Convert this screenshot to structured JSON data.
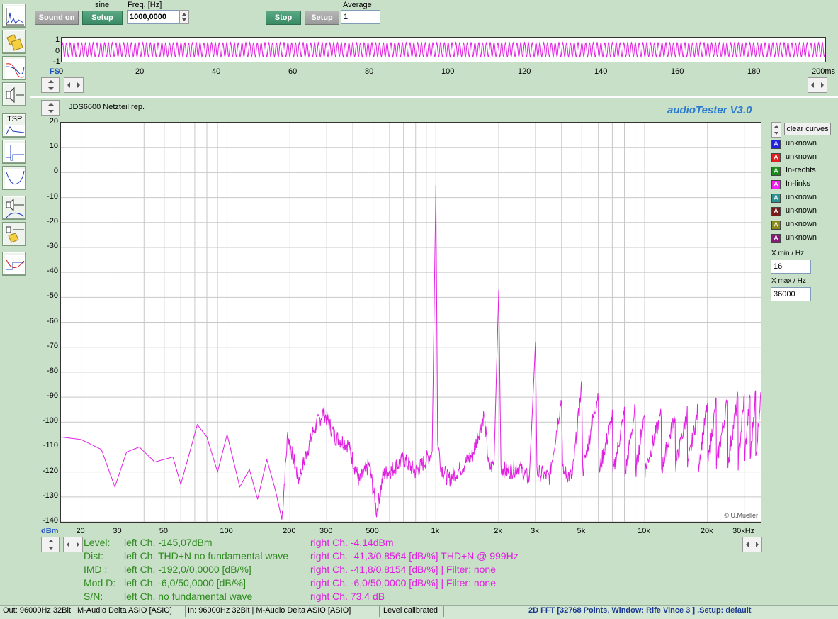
{
  "toolbar": {
    "sound_on": "Sound on",
    "generator_label": "sine",
    "setup1": "Setup",
    "freq_label": "Freq. [Hz]",
    "freq_value": "1000,0000",
    "stop": "Stop",
    "setup2": "Setup",
    "average_label": "Average",
    "average_value": "1"
  },
  "scope": {
    "y_ticks": [
      "1",
      "0",
      "-1"
    ],
    "fs_label": "FS",
    "x_ticks": [
      "0",
      "20",
      "40",
      "60",
      "80",
      "100",
      "120",
      "140",
      "160",
      "180",
      "200ms"
    ]
  },
  "panel": {
    "title": "JDS6600 Netzteil rep.",
    "app_name": "audioTester  V3.0",
    "copyright": "© U.Mueller",
    "clear_curves": "clear curves",
    "x_min_label": "X min / Hz",
    "x_min_value": "16",
    "x_max_label": "X max / Hz",
    "x_max_value": "36000"
  },
  "legend": [
    {
      "mark": "A",
      "label": "unknown",
      "color": "#2020e0"
    },
    {
      "mark": "A",
      "label": "unknown",
      "color": "#e02020"
    },
    {
      "mark": "A",
      "label": "In-rechts",
      "color": "#1a8a1a"
    },
    {
      "mark": "A",
      "label": "In-links",
      "color": "#f020f0"
    },
    {
      "mark": "A",
      "label": "unknown",
      "color": "#2a9090"
    },
    {
      "mark": "A",
      "label": "unknown",
      "color": "#7a1a1a"
    },
    {
      "mark": "A",
      "label": "unknown",
      "color": "#8a8a1a"
    },
    {
      "mark": "A",
      "label": "unknown",
      "color": "#8a1a7a"
    }
  ],
  "chart_data": {
    "type": "line",
    "xscale": "log",
    "xlim": [
      16,
      36000
    ],
    "ylim": [
      -140,
      20
    ],
    "y_ticks": [
      "20",
      "10",
      "0",
      "-10",
      "-20",
      "-30",
      "-40",
      "-50",
      "-60",
      "-70",
      "-80",
      "-90",
      "-100",
      "-110",
      "-120",
      "-130",
      "-140"
    ],
    "y_unit": "dBm",
    "x_tick_labels": [
      {
        "x": 20,
        "label": "20"
      },
      {
        "x": 30,
        "label": "30"
      },
      {
        "x": 50,
        "label": "50"
      },
      {
        "x": 100,
        "label": "100"
      },
      {
        "x": 200,
        "label": "200"
      },
      {
        "x": 300,
        "label": "300"
      },
      {
        "x": 500,
        "label": "500"
      },
      {
        "x": 1000,
        "label": "1k"
      },
      {
        "x": 2000,
        "label": "2k"
      },
      {
        "x": 3000,
        "label": "3k"
      },
      {
        "x": 5000,
        "label": "5k"
      },
      {
        "x": 10000,
        "label": "10k"
      },
      {
        "x": 20000,
        "label": "20k"
      },
      {
        "x": 30000,
        "label": "30kHz"
      }
    ],
    "series": [
      {
        "color": "#e020e0",
        "points": [
          [
            16,
            -106
          ],
          [
            20,
            -107
          ],
          [
            25,
            -111
          ],
          [
            29,
            -126
          ],
          [
            33,
            -112
          ],
          [
            38,
            -110
          ],
          [
            45,
            -116
          ],
          [
            55,
            -114
          ],
          [
            60,
            -125
          ],
          [
            72,
            -101
          ],
          [
            80,
            -106
          ],
          [
            90,
            -120
          ],
          [
            100,
            -105
          ],
          [
            115,
            -126
          ],
          [
            128,
            -119
          ],
          [
            140,
            -131
          ],
          [
            155,
            -115
          ],
          [
            170,
            -127
          ],
          [
            183,
            -139
          ],
          [
            195,
            -105
          ],
          [
            220,
            -123
          ],
          [
            260,
            -103
          ],
          [
            290,
            -96
          ],
          [
            330,
            -106
          ],
          [
            380,
            -109
          ],
          [
            430,
            -124
          ],
          [
            480,
            -117
          ],
          [
            520,
            -136
          ],
          [
            560,
            -121
          ],
          [
            620,
            -119
          ],
          [
            700,
            -115
          ],
          [
            800,
            -120
          ],
          [
            900,
            -115
          ],
          [
            960,
            -112
          ],
          [
            1000,
            -5
          ],
          [
            1020,
            -108
          ],
          [
            1060,
            -118
          ],
          [
            1150,
            -123
          ],
          [
            1300,
            -119
          ],
          [
            1500,
            -113
          ],
          [
            1700,
            -97
          ],
          [
            1800,
            -119
          ],
          [
            1900,
            -116
          ],
          [
            2000,
            -47
          ],
          [
            2050,
            -118
          ],
          [
            2200,
            -120
          ],
          [
            2500,
            -118
          ],
          [
            2800,
            -123
          ],
          [
            3000,
            -68
          ],
          [
            3050,
            -120
          ],
          [
            3500,
            -122
          ],
          [
            4000,
            -90
          ],
          [
            4050,
            -120
          ],
          [
            4500,
            -122
          ],
          [
            5000,
            -85
          ],
          [
            5050,
            -120
          ],
          [
            6000,
            -88
          ],
          [
            6050,
            -120
          ],
          [
            7000,
            -98
          ],
          [
            7050,
            -121
          ],
          [
            8000,
            -96
          ],
          [
            8050,
            -121
          ],
          [
            9000,
            -95
          ],
          [
            9050,
            -120
          ],
          [
            10000,
            -96
          ],
          [
            10050,
            -119
          ],
          [
            12000,
            -97
          ],
          [
            12050,
            -119
          ],
          [
            14000,
            -97
          ],
          [
            14050,
            -118
          ],
          [
            16000,
            -96
          ],
          [
            16050,
            -118
          ],
          [
            18000,
            -95
          ],
          [
            18050,
            -118
          ],
          [
            20000,
            -93
          ],
          [
            20050,
            -117
          ],
          [
            22000,
            -92
          ],
          [
            22050,
            -117
          ],
          [
            25000,
            -91
          ],
          [
            25050,
            -116
          ],
          [
            28000,
            -90
          ],
          [
            28050,
            -116
          ],
          [
            30000,
            -90
          ],
          [
            30050,
            -115
          ],
          [
            32000,
            -89
          ],
          [
            32050,
            -115
          ],
          [
            34000,
            -88
          ],
          [
            34050,
            -115
          ],
          [
            36000,
            -88
          ]
        ]
      }
    ]
  },
  "results": {
    "level": {
      "label": "Level:",
      "left": "left Ch. -145,07dBm",
      "right": "right Ch. -4,14dBm"
    },
    "dist": {
      "label": "Dist:",
      "left": "left Ch. THD+N  no fundamental wave",
      "right": "right Ch. -41,3/0,8564 [dB/%] THD+N  @ 999Hz"
    },
    "imd": {
      "label": "IMD  :",
      "left": "left Ch. -192,0/0,0000 [dB/%]",
      "right": "right Ch. -41,8/0,8154 [dB/%] |   Filter: none"
    },
    "modd": {
      "label": "Mod D:",
      "left": "left Ch. -6,0/50,0000 [dB/%]",
      "right": "right Ch. -6,0/50,0000 [dB/%] |   Filter: none"
    },
    "sn": {
      "label": "S/N:",
      "left": "left Ch.  no fundamental wave",
      "right": "right Ch. 73,4 dB"
    }
  },
  "status": {
    "out": "Out: 96000Hz 32Bit  | M-Audio Delta ASIO [ASIO]",
    "in": "In: 96000Hz 32Bit  | M-Audio Delta ASIO [ASIO]",
    "calibrated": "Level calibrated",
    "mode": "2D FFT [32768 Points, Window: Rife Vince 3 ]  .Setup:  default"
  },
  "sidebar": {
    "tsp_label": "TSP"
  }
}
